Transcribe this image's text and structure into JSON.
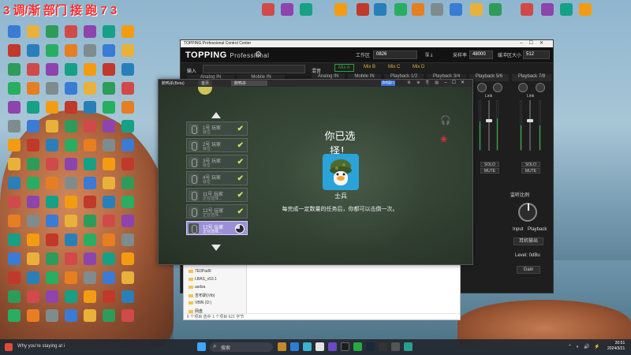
{
  "desktop": {
    "banner": "3 调/渐 部门 接 跑 7 3",
    "icons_left": [
      {
        "label": "",
        "color": "#3a7bd5"
      },
      {
        "label": "",
        "color": "#e8b13a"
      },
      {
        "label": "",
        "color": "#2d9c5a"
      },
      {
        "label": "",
        "color": "#d14a4a"
      }
    ]
  },
  "topping": {
    "title_bar": "TOPPING Professional Control Center",
    "logo": "TOPPING",
    "logo_sub": "Professional",
    "workspace_label": "工作区",
    "workspace_value": "0826",
    "sample_rate_label": "采样率",
    "sample_rate_value": "48000",
    "buffer_label": "缓冲区大小",
    "buffer_value": "512",
    "input_label": "输入",
    "mix_label": "混音",
    "channels_left": [
      "Analog IN",
      "Mobile IN"
    ],
    "mix_tabs": [
      "Mix A",
      "Mix B",
      "Mix C",
      "Mix D"
    ],
    "channels_right": [
      "Analog IN",
      "Mobile IN",
      "Playback 1/2",
      "Playback 3/4",
      "Playback 5/6",
      "Playback 7/8"
    ],
    "link_label": "Link",
    "solo_label": "SOLO",
    "mute_label": "MUTE",
    "monitor_label": "监听比例",
    "input_text": "Input",
    "playback_text": "Playback",
    "headphone_label": "耳机输出",
    "level_label": "Level: 0dBu",
    "gain_label": "Gain"
  },
  "game": {
    "window_title": "鹅鸭杀(Beta)",
    "tabs": [
      "首页",
      "鹅鸭杀"
    ],
    "badge": "游戏窗口",
    "players": [
      {
        "name": "1号 玩家",
        "status": "就位",
        "done": true
      },
      {
        "name": "2号 玩家",
        "status": "就位",
        "done": true
      },
      {
        "name": "3号 玩家",
        "status": "就位",
        "done": true
      },
      {
        "name": "4号 玩家",
        "status": "就位",
        "done": true
      },
      {
        "name": "11号 玩家",
        "status": "正在选择...",
        "done": true
      },
      {
        "name": "12号 玩家",
        "status": "正在选择...",
        "done": false
      }
    ],
    "progress": 0.75,
    "choose_title": "你已选择！",
    "role_name": "士兵",
    "description": "每完成一定数量的任务后，你都可以击倒一次。"
  },
  "explorer": {
    "items": [
      "7E0Pad9",
      "LBAS_v53.1",
      "asdsa",
      "吉布斯(Vib)",
      "VBlN (D:)",
      "网盘"
    ],
    "status": "6 个项目  选中 1 个项目  621 字节"
  },
  "taskbar": {
    "weather": "Why you're staying at i",
    "search_placeholder": "搜索",
    "time": "20:51",
    "date": "2024/3/21"
  }
}
